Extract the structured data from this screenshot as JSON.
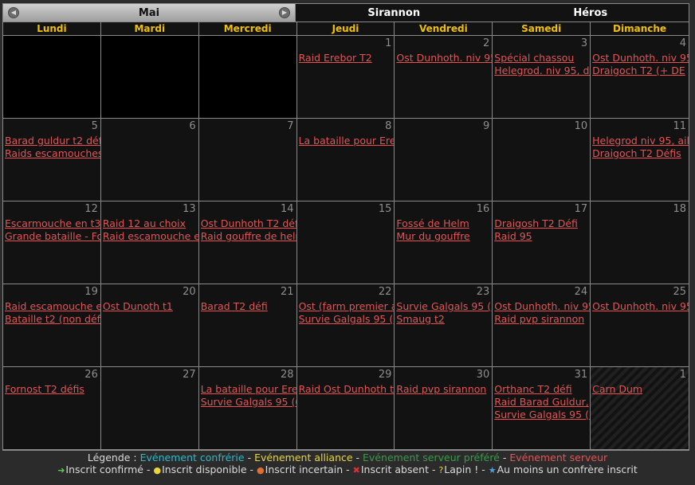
{
  "header": {
    "month": "Mai",
    "server": "Sirannon",
    "character": "Héros"
  },
  "days": [
    "Lundi",
    "Mardi",
    "Mercredi",
    "Jeudi",
    "Vendredi",
    "Samedi",
    "Dimanche"
  ],
  "weeks": [
    [
      {
        "blank": true
      },
      {
        "blank": true
      },
      {
        "blank": true
      },
      {
        "num": "1",
        "events": [
          "Raid Erebor T2"
        ]
      },
      {
        "num": "2",
        "events": [
          "Ost Dunhoth. niv 95"
        ]
      },
      {
        "num": "3",
        "events": [
          "Spécial chassou",
          "Helegrod. niv 95, dé"
        ]
      },
      {
        "num": "4",
        "events": [
          "Ost Dunhoth. niv 95",
          "Draigoch T2 (+ DE"
        ]
      }
    ],
    [
      {
        "num": "5",
        "events": [
          "Barad guldur t2 défis",
          "Raids escamouches"
        ]
      },
      {
        "num": "6",
        "events": []
      },
      {
        "num": "7",
        "events": []
      },
      {
        "num": "8",
        "events": [
          "La bataille pour Erebor"
        ]
      },
      {
        "num": "9",
        "events": []
      },
      {
        "num": "10",
        "events": []
      },
      {
        "num": "11",
        "events": [
          "Helegrod niv 95, aile",
          "Draigoch T2 Défis"
        ]
      }
    ],
    [
      {
        "num": "12",
        "events": [
          "Escarmouche en t3",
          "Grande bataille - Fo"
        ]
      },
      {
        "num": "13",
        "events": [
          "Raid 12 au choix",
          "Raid escamouche et"
        ]
      },
      {
        "num": "14",
        "events": [
          "Ost Dunhoth T2 défi",
          "Raid gouffre de helm"
        ]
      },
      {
        "num": "15",
        "events": []
      },
      {
        "num": "16",
        "events": [
          "Fossé de Helm",
          "Mur du gouffre"
        ]
      },
      {
        "num": "17",
        "events": [
          "Draigosh T2 Défi",
          "Raid 95"
        ]
      },
      {
        "num": "18",
        "events": []
      }
    ],
    [
      {
        "num": "19",
        "events": [
          "Raid escamouche et",
          "Bataille t2 (non défi"
        ]
      },
      {
        "num": "20",
        "events": [
          "Ost Dunoth t1"
        ]
      },
      {
        "num": "21",
        "events": [
          "Barad T2 défi"
        ]
      },
      {
        "num": "22",
        "events": [
          "Ost (farm premier a",
          "Survie Galgals 95 (r"
        ]
      },
      {
        "num": "23",
        "events": [
          "Survie Galgals 95 (r",
          "Smaug t2"
        ]
      },
      {
        "num": "24",
        "events": [
          "Ost Dunhoth. niv 95",
          "Raid pvp sirannon"
        ]
      },
      {
        "num": "25",
        "events": [
          "Ost Dunhoth. niv 95"
        ]
      }
    ],
    [
      {
        "num": "26",
        "events": [
          "Fornost T2 défis"
        ]
      },
      {
        "num": "27",
        "events": []
      },
      {
        "num": "28",
        "events": [
          "La bataille pour Erebor",
          "Survie Galgals 95 (6"
        ]
      },
      {
        "num": "29",
        "events": [
          "Raid Ost Dunhoth t"
        ]
      },
      {
        "num": "30",
        "events": [
          "Raid pvp sirannon"
        ]
      },
      {
        "num": "31",
        "events": [
          "Orthanc T2 défi",
          "Raid Barad Guldur,",
          "Survie Galgals 95 (r"
        ]
      },
      {
        "num": "1",
        "events": [
          "Carn Dum"
        ],
        "other_month": true
      }
    ]
  ],
  "legend": {
    "label": "Légende :",
    "items": [
      {
        "text": "Evénement confrérie",
        "color": "#2fb8c8"
      },
      {
        "text": "Evénement alliance",
        "color": "#e8d640"
      },
      {
        "text": "Evénement serveur préféré",
        "color": "#3a9a4a"
      },
      {
        "text": "Evénement serveur",
        "color": "#e05555"
      }
    ],
    "status": [
      {
        "symbol": "➜",
        "text": "Inscrit confirmé",
        "color": "#55cc55"
      },
      {
        "symbol": "●",
        "text": "Inscrit disponible",
        "color": "#e8d640"
      },
      {
        "symbol": "●",
        "text": "Inscrit incertain",
        "color": "#e07030"
      },
      {
        "symbol": "✖",
        "text": "Inscrit absent",
        "color": "#e03030"
      },
      {
        "symbol": "?",
        "text": "Lapin !",
        "color": "#e8d640"
      },
      {
        "symbol": "★",
        "text": "Au moins un confrère inscrit",
        "color": "#4aa0e8"
      }
    ]
  },
  "colors": {
    "event": "#e05555",
    "day_header": "#f0c000",
    "day_number": "#8e8e8e",
    "cell_bg": "#121212"
  }
}
